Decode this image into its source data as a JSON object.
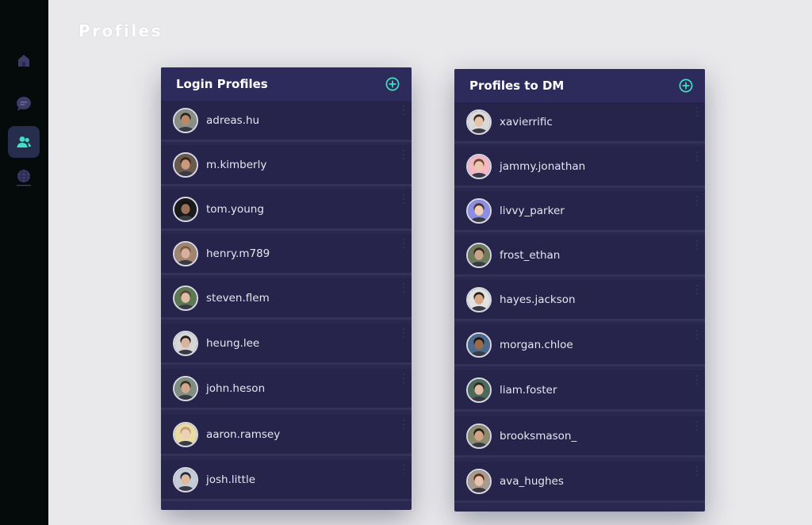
{
  "page": {
    "title": "Profiles"
  },
  "sidebar": {
    "items": [
      {
        "name": "home",
        "icon": "home-icon",
        "active": false
      },
      {
        "name": "messages",
        "icon": "chat-icon",
        "active": false
      },
      {
        "name": "profiles",
        "icon": "users-icon",
        "active": true
      },
      {
        "name": "browser",
        "icon": "globe-icon",
        "active": false
      }
    ]
  },
  "login_panel": {
    "title": "Login Profiles",
    "add_icon": "plus-circle-icon",
    "profiles": [
      {
        "username": "adreas.hu",
        "avatar_bg": "#8a8f86",
        "skin": "#b98a6a",
        "hair": "#2a2420"
      },
      {
        "username": "m.kimberly",
        "avatar_bg": "#6a5a4e",
        "skin": "#c89a7a",
        "hair": "#3a2418"
      },
      {
        "username": "tom.young",
        "avatar_bg": "#1a1a1a",
        "skin": "#9a7058",
        "hair": "#141010"
      },
      {
        "username": "henry.m789",
        "avatar_bg": "#a08670",
        "skin": "#d6b09a",
        "hair": "#7a5a40"
      },
      {
        "username": "steven.flem",
        "avatar_bg": "#5c7a52",
        "skin": "#e2bda6",
        "hair": "#5a4634"
      },
      {
        "username": "heung.lee",
        "avatar_bg": "#d6d6d6",
        "skin": "#d8b49a",
        "hair": "#1c1c1c"
      },
      {
        "username": "john.heson",
        "avatar_bg": "#7e8e80",
        "skin": "#d2a88c",
        "hair": "#3c3026"
      },
      {
        "username": "aaron.ramsey",
        "avatar_bg": "#e9dca2",
        "skin": "#efd0b6",
        "hair": "#c0a070"
      },
      {
        "username": "josh.little",
        "avatar_bg": "#c4ccd6",
        "skin": "#e0b89a",
        "hair": "#202a40"
      }
    ]
  },
  "dm_panel": {
    "title": "Profiles to DM",
    "add_icon": "plus-circle-icon",
    "profiles": [
      {
        "username": "xavierrific",
        "avatar_bg": "#d9d9d9",
        "skin": "#e6c4aa",
        "hair": "#3a2a20"
      },
      {
        "username": "jammy.jonathan",
        "avatar_bg": "#f2b8c6",
        "skin": "#eec6ae",
        "hair": "#6a4a34"
      },
      {
        "username": "livvy_parker",
        "avatar_bg": "#8c8ee6",
        "skin": "#f0cdb6",
        "hair": "#4a3426"
      },
      {
        "username": "frost_ethan",
        "avatar_bg": "#6e7a5c",
        "skin": "#caa488",
        "hair": "#3a2a1c"
      },
      {
        "username": "hayes.jackson",
        "avatar_bg": "#e2e2e2",
        "skin": "#d6a888",
        "hair": "#2c2018"
      },
      {
        "username": "morgan.chloe",
        "avatar_bg": "#4a6a8e",
        "skin": "#9a6a4e",
        "hair": "#181410"
      },
      {
        "username": "liam.foster",
        "avatar_bg": "#4c6a5a",
        "skin": "#e2bca0",
        "hair": "#2e2a24"
      },
      {
        "username": "brooksmason_",
        "avatar_bg": "#8a8a6e",
        "skin": "#d2a486",
        "hair": "#241c16"
      },
      {
        "username": "ava_hughes",
        "avatar_bg": "#a89a8e",
        "skin": "#e8c2aa",
        "hair": "#5a2a1a"
      }
    ]
  },
  "colors": {
    "accent": "#3fe0c5",
    "panel_bg": "#26244b",
    "panel_header": "#2d2b5c",
    "sidebar_bg": "#050a0b",
    "page_bg": "#e9e9ec"
  }
}
